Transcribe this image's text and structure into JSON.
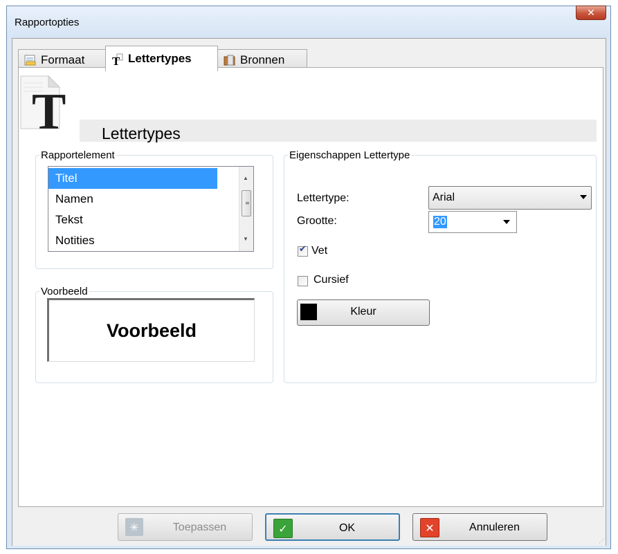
{
  "window": {
    "title": "Rapportopties"
  },
  "tabs": [
    {
      "label": "Formaat",
      "icon": "format-icon"
    },
    {
      "label": "Lettertypes",
      "icon": "font-icon"
    },
    {
      "label": "Bronnen",
      "icon": "sources-icon"
    }
  ],
  "header": {
    "title": "Lettertypes",
    "icon": "large-font-T-icon"
  },
  "report_element": {
    "legend": "Rapportelement",
    "items": [
      "Titel",
      "Namen",
      "Tekst",
      "Notities"
    ],
    "selected": "Titel"
  },
  "preview": {
    "legend": "Voorbeeld",
    "text": "Voorbeeld"
  },
  "font_props": {
    "legend": "Eigenschappen Lettertype",
    "font_label": "Lettertype:",
    "font_value": "Arial",
    "size_label": "Grootte:",
    "size_value": "20",
    "bold_label": "Vet",
    "bold_checked": true,
    "italic_label": "Cursief",
    "italic_checked": false,
    "color_button": "Kleur",
    "color_value": "#000000"
  },
  "footer": {
    "apply": "Toepassen",
    "ok": "OK",
    "cancel": "Annuleren"
  }
}
